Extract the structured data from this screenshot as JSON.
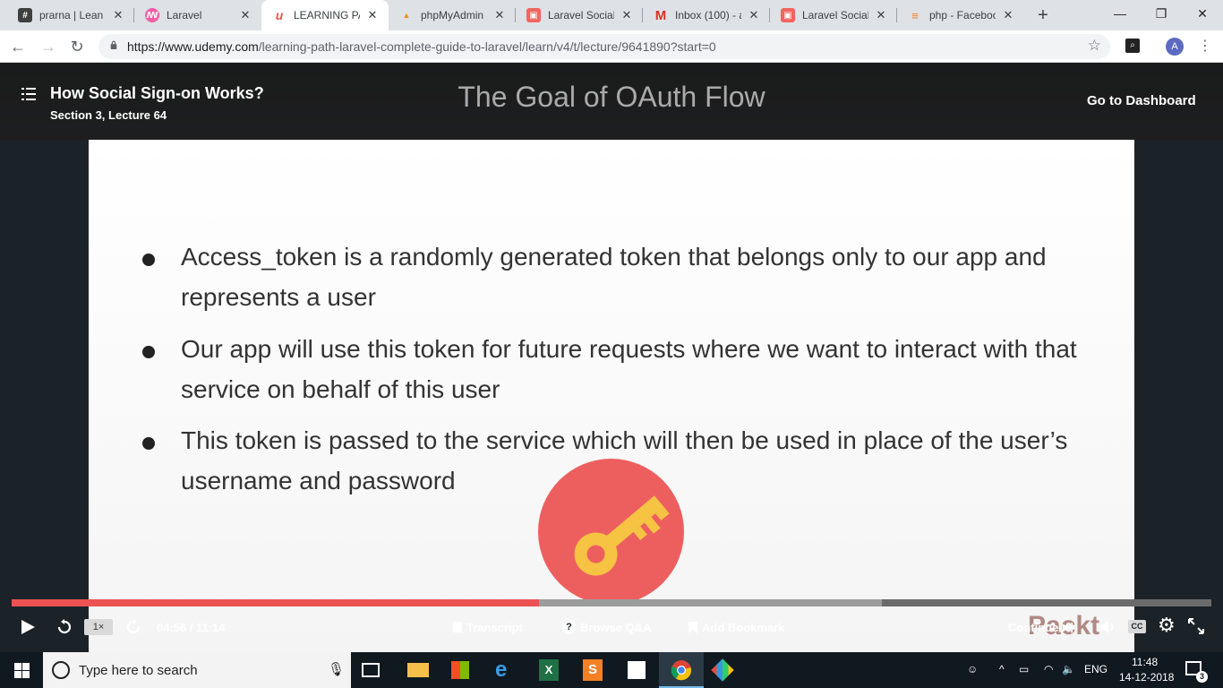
{
  "browser": {
    "tabs": [
      {
        "title": "prarna | Lean A",
        "icon": "slack-icon"
      },
      {
        "title": "Laravel",
        "icon": "laravel-logo-icon"
      },
      {
        "title": "LEARNING PAT",
        "icon": "udemy-icon",
        "active": true
      },
      {
        "title": "phpMyAdmin",
        "icon": "phpmyadmin-icon"
      },
      {
        "title": "Laravel Socialit",
        "icon": "laravel-icon"
      },
      {
        "title": "Inbox (100) - a",
        "icon": "gmail-icon"
      },
      {
        "title": "Laravel Socialit",
        "icon": "laravel-icon"
      },
      {
        "title": "php - Faceboo",
        "icon": "stackoverflow-icon"
      }
    ],
    "url_host": "https://www.udemy.com",
    "url_path": "/learning-path-laravel-complete-guide-to-laravel/learn/v4/t/lecture/9641890?start=0",
    "profile_initial": "A"
  },
  "lecture": {
    "title": "How Social Sign-on Works?",
    "subtitle": "Section 3, Lecture 64",
    "dashboard_link": "Go to Dashboard"
  },
  "slide": {
    "title": "The Goal of OAuth Flow",
    "bullets": [
      "Access_token is a randomly generated token that belongs only to our app and represents a user",
      "Our app will use this token for future requests where we want to interact with that service on behalf of this user",
      "This token is passed to the service which will then be used in place of the user’s username and password"
    ],
    "colors": {
      "key_circle": "#ed5f5f",
      "key": "#f6c343"
    }
  },
  "controls": {
    "speed": "1×",
    "time": "04:56 / 11:14",
    "progress_fraction": 0.4393,
    "buffered_fraction": 0.725,
    "transcript": "Transcript",
    "browse_qa": "Browse Q&A",
    "add_bookmark": "Add Bookmark",
    "continue": "Continue",
    "watermark": "Packt",
    "cc": "CC",
    "accent": "#ec5252"
  },
  "taskbar": {
    "search_placeholder": "Type here to search",
    "language": "ENG",
    "time": "11:48",
    "date": "14-12-2018",
    "notifications": "3"
  }
}
